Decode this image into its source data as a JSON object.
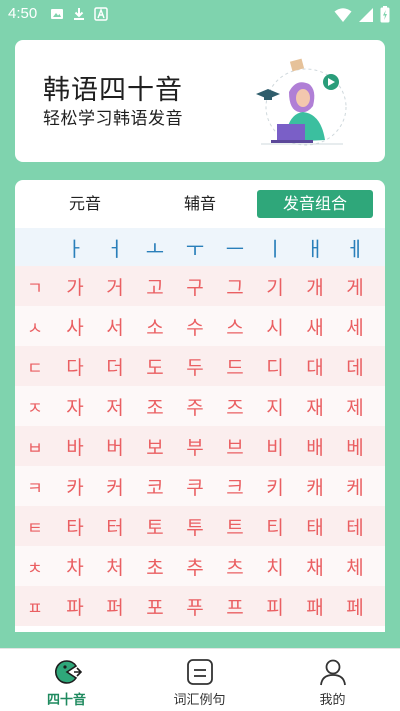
{
  "status_bar": {
    "time": "4:50",
    "left_icons": [
      "image-icon",
      "download-icon",
      "font-a-icon"
    ],
    "right_icons": [
      "wifi-icon",
      "signal-icon",
      "battery-charging-icon"
    ]
  },
  "hero": {
    "title": "韩语四十音",
    "subtitle": "轻松学习韩语发音",
    "illustration": "student-studying-illustration"
  },
  "tabs": [
    {
      "label": "元音",
      "active": false
    },
    {
      "label": "辅音",
      "active": false
    },
    {
      "label": "发音组合",
      "active": true
    }
  ],
  "table": {
    "vowels": [
      "ㅏ",
      "ㅓ",
      "ㅗ",
      "ㅜ",
      "ㅡ",
      "ㅣ",
      "ㅐ",
      "ㅔ"
    ],
    "rows": [
      {
        "consonant": "ㄱ",
        "syllables": [
          "가",
          "거",
          "고",
          "구",
          "그",
          "기",
          "개",
          "게"
        ]
      },
      {
        "consonant": "ㅅ",
        "syllables": [
          "사",
          "서",
          "소",
          "수",
          "스",
          "시",
          "새",
          "세"
        ]
      },
      {
        "consonant": "ㄷ",
        "syllables": [
          "다",
          "더",
          "도",
          "두",
          "드",
          "디",
          "대",
          "데"
        ]
      },
      {
        "consonant": "ㅈ",
        "syllables": [
          "자",
          "저",
          "조",
          "주",
          "즈",
          "지",
          "재",
          "제"
        ]
      },
      {
        "consonant": "ㅂ",
        "syllables": [
          "바",
          "버",
          "보",
          "부",
          "브",
          "비",
          "배",
          "베"
        ]
      },
      {
        "consonant": "ㅋ",
        "syllables": [
          "카",
          "커",
          "코",
          "쿠",
          "크",
          "키",
          "캐",
          "케"
        ]
      },
      {
        "consonant": "ㅌ",
        "syllables": [
          "타",
          "터",
          "토",
          "투",
          "트",
          "티",
          "태",
          "테"
        ]
      },
      {
        "consonant": "ㅊ",
        "syllables": [
          "차",
          "처",
          "초",
          "추",
          "츠",
          "치",
          "채",
          "체"
        ]
      },
      {
        "consonant": "ㅍ",
        "syllables": [
          "파",
          "퍼",
          "포",
          "푸",
          "프",
          "피",
          "패",
          "페"
        ]
      }
    ]
  },
  "bottom_nav": [
    {
      "label": "四十音",
      "icon": "pacman-chat-icon",
      "active": true
    },
    {
      "label": "词汇例句",
      "icon": "message-box-icon",
      "active": false
    },
    {
      "label": "我的",
      "icon": "user-icon",
      "active": false
    }
  ],
  "colors": {
    "background": "#7fd3ae",
    "accent": "#2fa77a",
    "vowel": "#2a7fba",
    "consonant": "#ea5f62"
  }
}
